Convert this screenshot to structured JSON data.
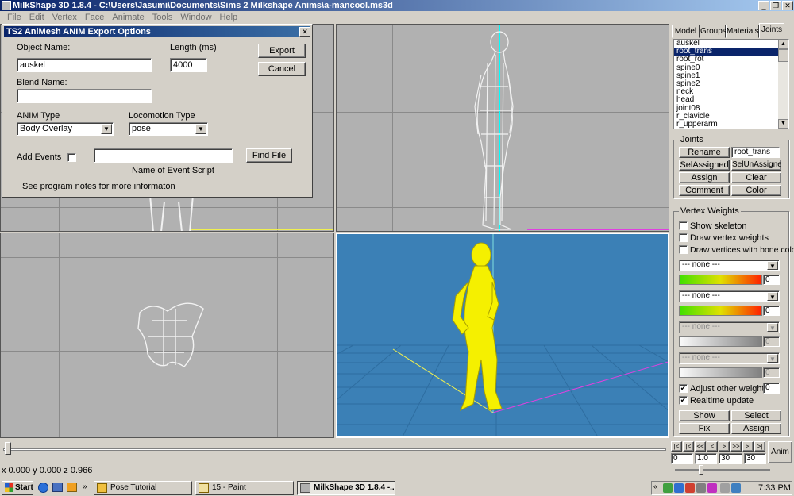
{
  "window": {
    "title": "MilkShape 3D 1.8.4 - C:\\Users\\Jasumi\\Documents\\Sims 2 Milkshape Anims\\a-mancool.ms3d"
  },
  "menu": [
    "File",
    "Edit",
    "Vertex",
    "Face",
    "Animate",
    "Tools",
    "Window",
    "Help"
  ],
  "dialog": {
    "title": "TS2 AniMesh ANIM Export Options",
    "object_name_label": "Object Name:",
    "object_name_value": "auskel",
    "length_label": "Length (ms)",
    "length_value": "4000",
    "blend_name_label": "Blend Name:",
    "blend_name_value": "",
    "anim_type_label": "ANIM Type",
    "anim_type_value": "Body Overlay",
    "locomotion_type_label": "Locomotion Type",
    "locomotion_type_value": "pose",
    "add_events_label": "Add Events",
    "event_script_value": "",
    "event_script_caption": "Name of Event Script",
    "find_file_label": "Find File",
    "export_label": "Export",
    "cancel_label": "Cancel",
    "notes": "See program notes for more informaton"
  },
  "tabs": [
    "Model",
    "Groups",
    "Materials",
    "Joints"
  ],
  "active_tab": "Joints",
  "joints_list": [
    "auskel",
    "root_trans",
    "root_rot",
    "spine0",
    "spine1",
    "spine2",
    "neck",
    "head",
    "joint08",
    "r_clavicle",
    "r_upperarm"
  ],
  "selected_joint": "root_trans",
  "joints_group": {
    "title": "Joints",
    "rename_label": "Rename",
    "rename_value": "root_trans",
    "sel_assigned_label": "SelAssigned",
    "sel_unassigned_label": "SelUnAssigned",
    "assign_label": "Assign",
    "clear_label": "Clear",
    "comment_label": "Comment",
    "color_label": "Color"
  },
  "vertex_weights": {
    "title": "Vertex Weights",
    "show_skeleton": "Show skeleton",
    "draw_vertex_weights": "Draw vertex weights",
    "draw_vertices_bone_colors": "Draw vertices with bone colors",
    "bone_slots": [
      {
        "value": "--- none ---",
        "weight": "0",
        "enabled": true
      },
      {
        "value": "--- none ---",
        "weight": "0",
        "enabled": true
      },
      {
        "value": "--- none ---",
        "weight": "0",
        "enabled": false
      },
      {
        "value": "--- none ---",
        "weight": "0",
        "enabled": false
      }
    ],
    "adjust_other_weights": "Adjust other weights",
    "adjust_other_weights_value": "0",
    "realtime_update": "Realtime update",
    "show_label": "Show",
    "select_label": "Select",
    "fix_label": "Fix",
    "assign_label": "Assign"
  },
  "anim": {
    "button_label": "Anim",
    "fields": [
      "0",
      "1.0",
      "30",
      "30"
    ],
    "nav": [
      "|<",
      "|<",
      "<<",
      "<",
      ">",
      ">>",
      ">|",
      ">|"
    ]
  },
  "status": {
    "coords": "x 0.000 y 0.000 z 0.966"
  },
  "taskbar": {
    "start": "Start",
    "items": [
      {
        "label": "Pose Tutorial",
        "active": false
      },
      {
        "label": "15 - Paint",
        "active": false
      },
      {
        "label": "MilkShape 3D 1.8.4 -...",
        "active": true
      }
    ],
    "clock": "7:33 PM"
  },
  "colors": {
    "title_blue": "#0a246a",
    "viewport_blue": "#3b80b6",
    "model_yellow": "#f5f000",
    "axis_cyan": "#00ffff",
    "axis_magenta": "#e040e0"
  }
}
